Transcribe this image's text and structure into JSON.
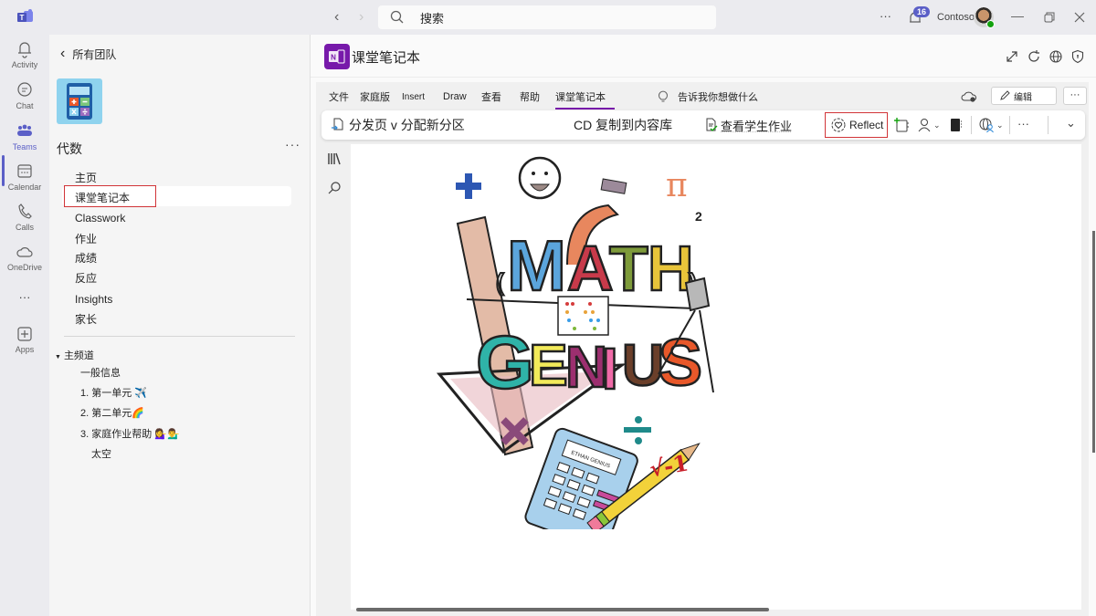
{
  "titlebar": {
    "search_placeholder": "搜索",
    "notification_count": "16",
    "org_name": "Contoso",
    "more_label": "···"
  },
  "rail": {
    "items": [
      {
        "label": "Activity",
        "icon": "bell-icon"
      },
      {
        "label": "Chat",
        "icon": "chat-icon"
      },
      {
        "label": "Teams",
        "icon": "teams-icon",
        "active": true
      },
      {
        "label": "Calendar",
        "icon": "calendar-icon"
      },
      {
        "label": "Calls",
        "icon": "phone-icon"
      },
      {
        "label": "OneDrive",
        "icon": "cloud-icon"
      },
      {
        "label": "···",
        "icon": "more-icon"
      },
      {
        "label": "Apps",
        "icon": "add-app-icon"
      }
    ]
  },
  "team_panel": {
    "back_label": "所有团队",
    "team_name": "代数",
    "more": "···",
    "nav": [
      {
        "label": "主页"
      },
      {
        "label": "课堂笔记本",
        "selected": true
      },
      {
        "label": "Classwork"
      },
      {
        "label": "作业"
      },
      {
        "label": "成绩"
      },
      {
        "label": "反应"
      },
      {
        "label": "Insights"
      },
      {
        "label": "家长"
      }
    ],
    "channel_group": "主频道",
    "channels": [
      {
        "label": "一般信息"
      },
      {
        "label": "1. 第一单元 ✈️"
      },
      {
        "label": "2. 第二单元🌈"
      },
      {
        "label": "3. 家庭作业帮助 💁‍♀️💁‍♂️"
      },
      {
        "label": "太空"
      }
    ]
  },
  "onenote": {
    "title": "课堂笔记本",
    "logo_text": "N",
    "tabs": [
      {
        "label": "文件"
      },
      {
        "label": "家庭版"
      },
      {
        "label": "Insert"
      },
      {
        "label": "Draw"
      },
      {
        "label": "查看"
      },
      {
        "label": "帮助"
      },
      {
        "label": "课堂笔记本",
        "active": true
      }
    ],
    "tell_me": "告诉我你想做什么",
    "edit_label": "编辑",
    "more_label": "···",
    "commands": {
      "distribute": "分发页 v 分配新分区",
      "copy": "CD 复制到内容库",
      "review": "查看学生作业",
      "reflect": "Reflect"
    },
    "page_image": {
      "title_line1": "(MATH)²",
      "title_line2": "GENIUS",
      "calculator_label": "ETHAN GENIUS",
      "pencil_label": "√-1"
    }
  }
}
